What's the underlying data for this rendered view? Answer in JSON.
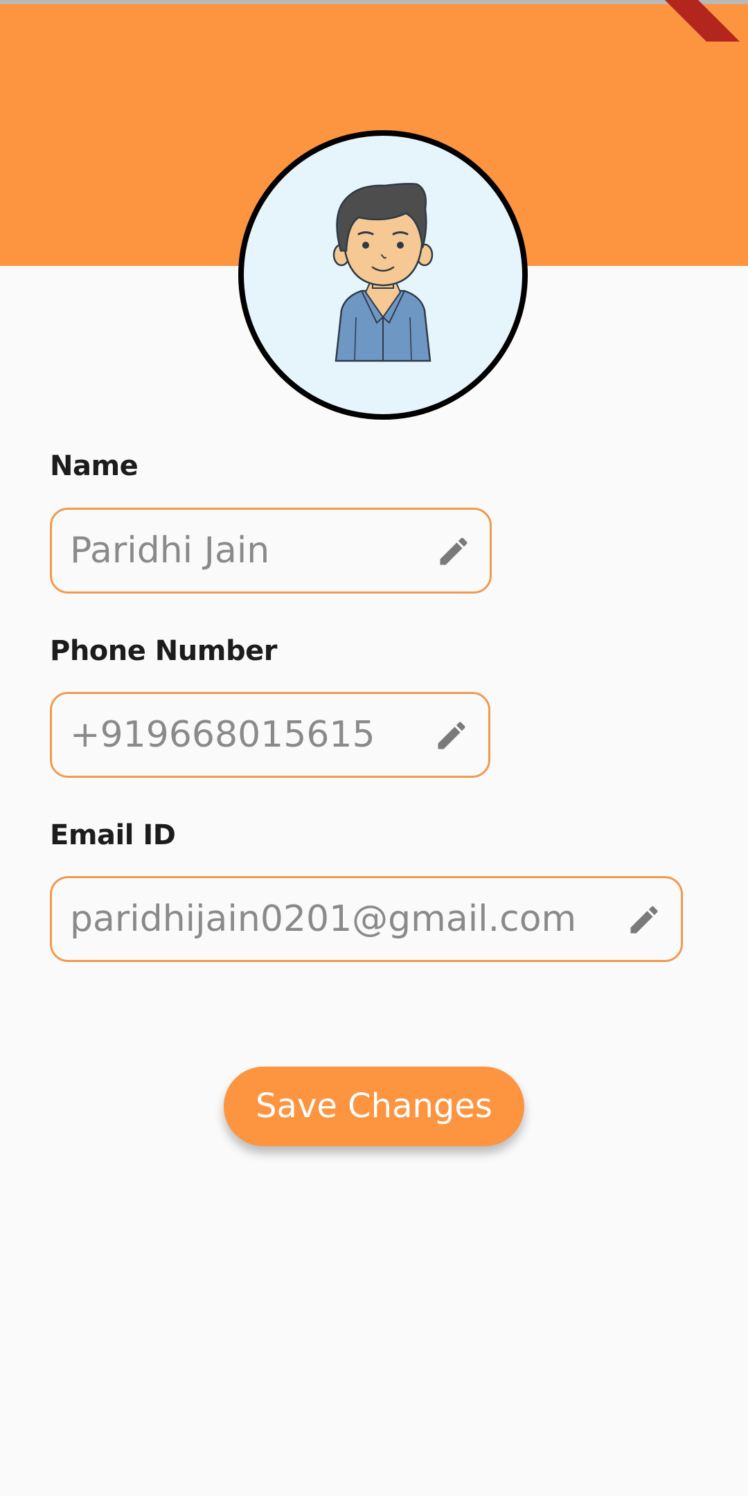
{
  "colors": {
    "accent": "#fd9440",
    "field_border": "#f09a4e",
    "background": "#fafafa"
  },
  "profile": {
    "avatar_icon": "male-user-avatar"
  },
  "fields": [
    {
      "label": "Name",
      "value": "Paridhi Jain",
      "icon": "pencil-edit-icon"
    },
    {
      "label": "Phone Number",
      "value": "+919668015615",
      "icon": "pencil-edit-icon"
    },
    {
      "label": "Email ID",
      "value": "paridhijain0201@gmail.com",
      "icon": "pencil-edit-icon"
    }
  ],
  "actions": {
    "save_label": "Save Changes"
  }
}
